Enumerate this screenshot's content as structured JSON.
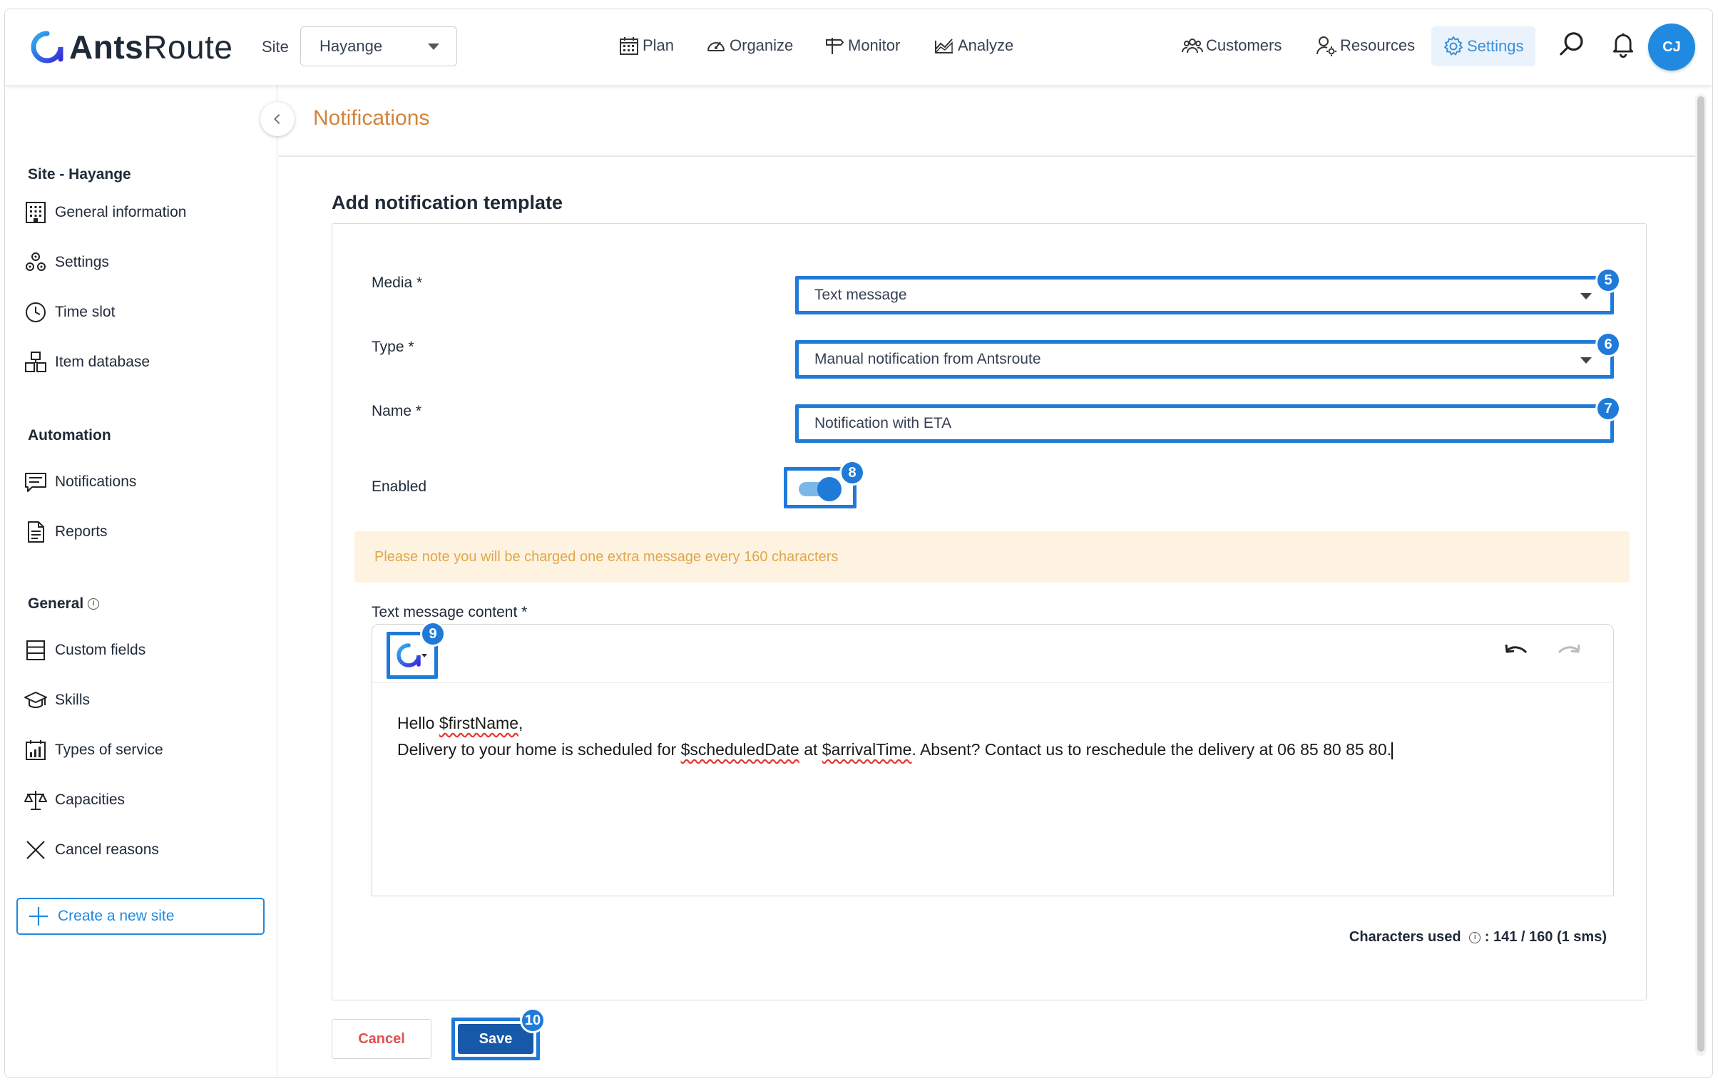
{
  "header": {
    "logo_text_bold": "Ants",
    "logo_text_light": "Route",
    "site_label": "Site",
    "site_value": "Hayange",
    "nav": {
      "plan": "Plan",
      "organize": "Organize",
      "monitor": "Monitor",
      "analyze": "Analyze",
      "customers": "Customers",
      "resources": "Resources",
      "settings": "Settings"
    },
    "avatar_initials": "CJ",
    "accent_color": "#1f8ae0"
  },
  "sidebar": {
    "site_section": "Site - Hayange",
    "site_items": [
      {
        "label": "General information",
        "icon": "building-icon"
      },
      {
        "label": "Settings",
        "icon": "cogs-icon"
      },
      {
        "label": "Time slot",
        "icon": "clock-icon"
      },
      {
        "label": "Item database",
        "icon": "boxes-icon"
      }
    ],
    "automation_section": "Automation",
    "automation_items": [
      {
        "label": "Notifications",
        "icon": "message-icon"
      },
      {
        "label": "Reports",
        "icon": "document-icon"
      }
    ],
    "general_section": "General",
    "general_items": [
      {
        "label": "Custom fields",
        "icon": "list-icon"
      },
      {
        "label": "Skills",
        "icon": "graduation-cap-icon"
      },
      {
        "label": "Types of service",
        "icon": "calendar-chart-icon"
      },
      {
        "label": "Capacities",
        "icon": "balance-scale-icon"
      },
      {
        "label": "Cancel reasons",
        "icon": "x-icon"
      }
    ],
    "create_site": "Create a new site"
  },
  "page": {
    "title": "Notifications",
    "form_title": "Add notification template"
  },
  "form": {
    "media_label": "Media *",
    "media_value": "Text message",
    "type_label": "Type *",
    "type_value": "Manual notification from Antsroute",
    "name_label": "Name *",
    "name_value": "Notification with ETA",
    "enabled_label": "Enabled",
    "enabled": true,
    "notice": "Please note you will be charged one extra message every 160 characters",
    "content_label": "Text message content *",
    "content": {
      "line1_prefix": "Hello ",
      "line1_var": "$firstName",
      "line1_suffix": ",",
      "line2_a": "Delivery to your home is scheduled for ",
      "line2_var1": "$scheduledDate",
      "line2_b": " at ",
      "line2_var2": "$arrivalTime",
      "line2_c": ". Absent? Contact us to reschedule the delivery at 06 85 80 85 80."
    },
    "chars_label": "Characters used",
    "chars_value": ": 141 / 160 (1 sms)",
    "cancel": "Cancel",
    "save": "Save"
  },
  "badges": {
    "media": "5",
    "type": "6",
    "name": "7",
    "enabled": "8",
    "variables": "9",
    "save": "10"
  }
}
